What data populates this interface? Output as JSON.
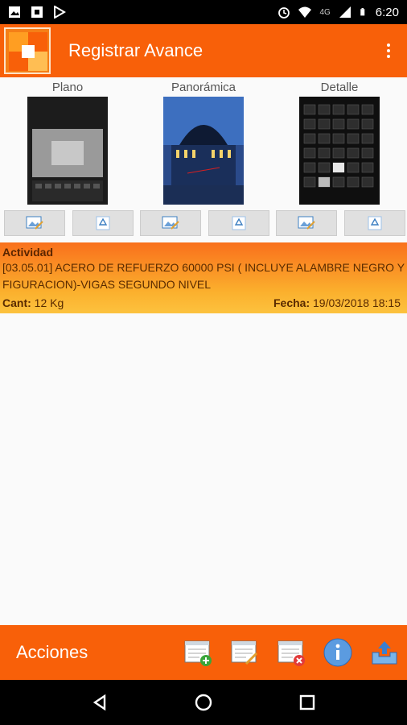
{
  "status": {
    "network": "4G",
    "time": "6:20"
  },
  "appbar": {
    "title": "Registrar Avance"
  },
  "photos": [
    {
      "label": "Plano"
    },
    {
      "label": "Panorámica"
    },
    {
      "label": "Detalle"
    }
  ],
  "actividad": {
    "title": "Actividad",
    "description": "[03.05.01] ACERO DE REFUERZO 60000 PSI ( INCLUYE ALAMBRE NEGRO Y FIGURACION)-VIGAS SEGUNDO NIVEL",
    "cant_label": "Cant:",
    "cant_value": "12 Kg",
    "fecha_label": "Fecha:",
    "fecha_value": "19/03/2018 18:15"
  },
  "bottombar": {
    "label": "Acciones"
  },
  "colors": {
    "accent": "#f86009",
    "gradient_end": "#fcc23e"
  }
}
